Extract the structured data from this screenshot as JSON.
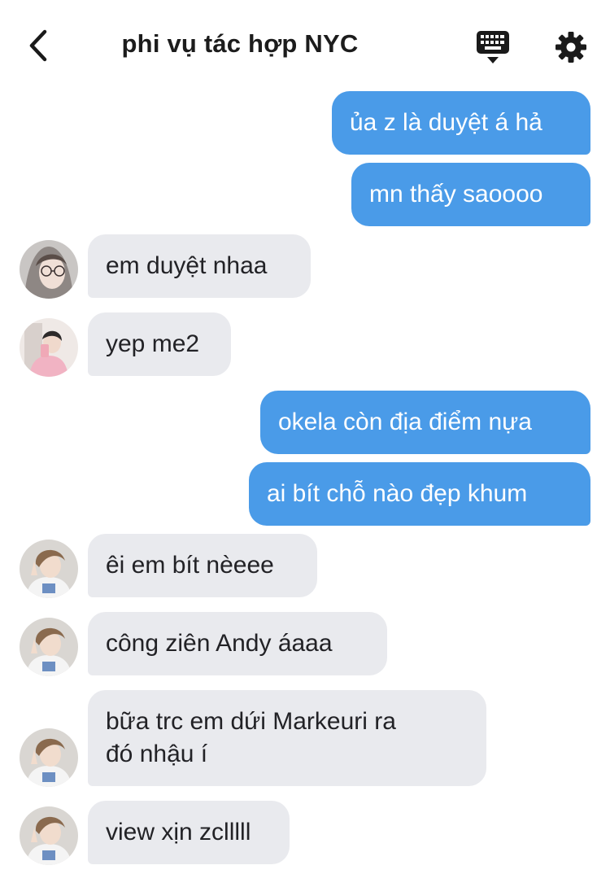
{
  "header": {
    "title": "phi vụ tác hợp NYC",
    "back_icon": "chevron-left-icon",
    "keyboard_icon": "keyboard-icon",
    "settings_icon": "gear-icon"
  },
  "colors": {
    "outgoing_bubble": "#4a9be8",
    "incoming_bubble": "#e9eaee",
    "text_dark": "#1c1c1c"
  },
  "messages": [
    {
      "sender": "me",
      "text": "ủa z là duyệt á hả"
    },
    {
      "sender": "me",
      "text": "mn thấy saoooo"
    },
    {
      "sender": "user-girl",
      "text": "em duyệt nhaa"
    },
    {
      "sender": "user-pink",
      "text": "yep me2"
    },
    {
      "sender": "me",
      "text": "okela còn địa điểm nựa"
    },
    {
      "sender": "me",
      "text": "ai bít chỗ nào đẹp khum"
    },
    {
      "sender": "user-boy",
      "text": "êi em bít nèeee"
    },
    {
      "sender": "user-boy",
      "text": "công ziên Andy áaaa"
    },
    {
      "sender": "user-boy",
      "text": "bữa trc em dứi Markeuri ra\nđó nhậu í"
    },
    {
      "sender": "user-boy",
      "text": "view xịn zclllll"
    }
  ]
}
